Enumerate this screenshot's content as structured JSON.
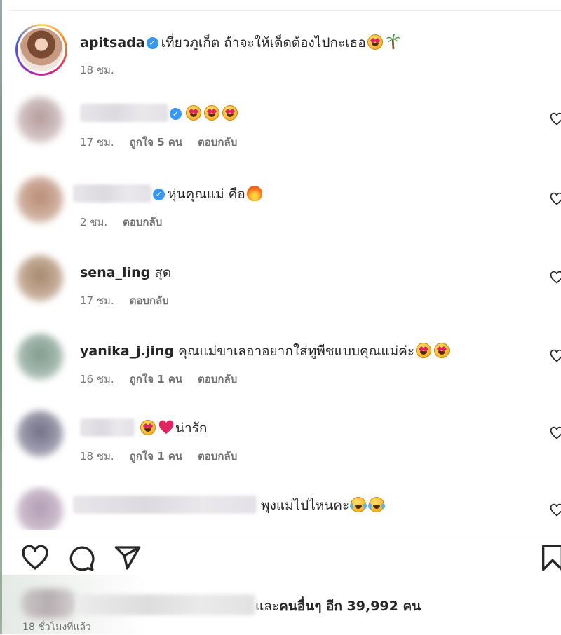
{
  "post": {
    "username": "apitsada",
    "caption": "เที่ยวภูเก็ต ถ้าจะให้เด็ดต้องไปกะเธอ",
    "time": "18 ชม."
  },
  "comments": [
    {
      "text": "",
      "time": "17 ชม.",
      "likes": "ถูกใจ 5 คน",
      "reply": "ตอบกลับ"
    },
    {
      "text": "หุ่นคุณแม่ คือ",
      "time": "2 ชม.",
      "reply": "ตอบกลับ"
    },
    {
      "username": "sena_ling",
      "text": "สุด",
      "time": "17 ชม.",
      "reply": "ตอบกลับ"
    },
    {
      "username": "yanika_j.jing",
      "text": "คุณแม่ขาเลอาอยากใส่ทูพีชแบบคุณแม่ค่ะ",
      "time": "16 ชม.",
      "likes": "ถูกใจ 1 คน",
      "reply": "ตอบกลับ"
    },
    {
      "text": "น่ารัก",
      "time": "18 ชม.",
      "likes": "ถูกใจ 1 คน",
      "reply": "ตอบกลับ"
    },
    {
      "text": "พุงแม่ไปไหนคะ"
    }
  ],
  "likes_summary": {
    "prefix": "และ",
    "others": "คนอื่นๆ อีก 39,992 คน"
  },
  "time_ago": "18 ชั่วโมงที่แล้ว",
  "icons": {
    "like": "heart-icon",
    "comment": "comment-icon",
    "share": "send-icon",
    "save": "bookmark-icon"
  },
  "colors": {
    "verified": "#3897f0",
    "meta_text": "#737373"
  }
}
